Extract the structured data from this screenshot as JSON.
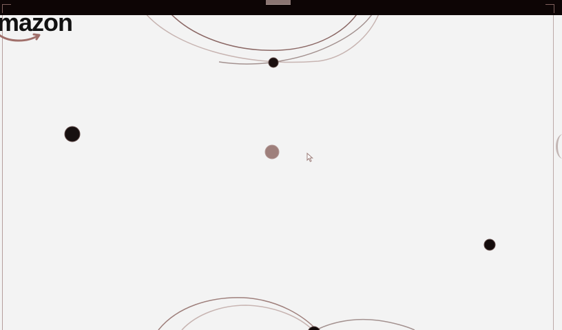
{
  "brand": {
    "logo_text": "mazon",
    "logo_icon": "amazon-smile-icon"
  },
  "scene": {
    "dots": [
      {
        "name": "dot-top-center",
        "shade": "#1a0f0f"
      },
      {
        "name": "dot-left",
        "shade": "#171010"
      },
      {
        "name": "dot-center",
        "shade": "#9e7f7b"
      },
      {
        "name": "dot-right",
        "shade": "#140c0c"
      },
      {
        "name": "dot-bottom-center",
        "shade": "#110909"
      }
    ],
    "arc_colors": [
      "#8b6865",
      "#a3918f",
      "#c7b4b1"
    ]
  },
  "cursor": {
    "icon": "mouse-pointer-icon"
  },
  "colors": {
    "background": "#f3f3f3",
    "top_bar": "#0d0505",
    "border": "#b49d9b"
  }
}
